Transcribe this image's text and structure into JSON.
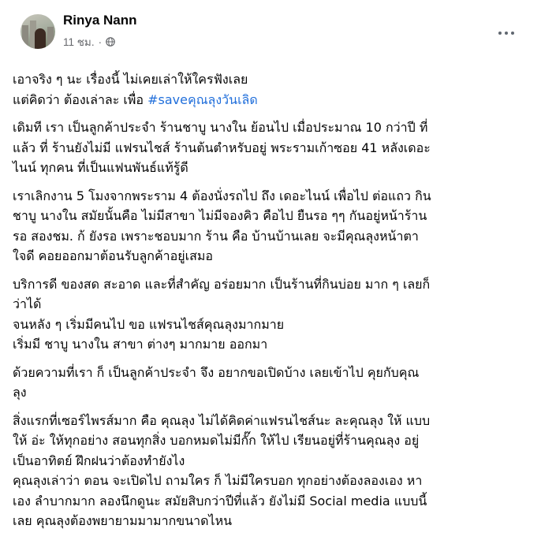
{
  "post": {
    "author": "Rinya Nann",
    "timestamp": "11 ชม.",
    "separator": "·",
    "privacy_icon": "globe-icon",
    "more_icon": "more-options-icon",
    "hashtag_color": "#216fdb",
    "paragraphs": [
      {
        "lines": [
          {
            "text": "เอาจริง ๆ นะ เรื่องนี้ ไม่เคยเล่าให้ใครฟังเลย"
          },
          {
            "text": "แต่คิดว่า ต้องเล่าละ เพื่อ ",
            "hashtag": "#saveคุณลุงวันเลิด"
          }
        ]
      },
      {
        "lines": [
          {
            "text": "เดิมที เรา เป็นลูกค้าประจำ ร้านชาบู นางใน ย้อนไป เมื่อประมาณ 10 กว่าปี ที่"
          },
          {
            "text": "แล้ว ที่ ร้านยังไม่มี แฟรนไชส์ ร้านต้นตำหรับอยู่ พระรามเก้าซอย 41 หลังเดอะ"
          },
          {
            "text": "ไนน์ ทุกคน ที่เป็นแฟนพันธ์แท้รู้ดี"
          }
        ]
      },
      {
        "lines": [
          {
            "text": "เราเลิกงาน 5 โมงจากพระราม 4 ต้องนั่งรถไป ถึง เดอะไนน์ เพื่อไป ต่อแถว กิน"
          },
          {
            "text": "ชาบู นางใน สมัยนั้นคือ ไม่มีสาขา ไม่มีจองคิว คือไป ยืนรอ ๆๆ กันอยู่หน้าร้าน"
          },
          {
            "text": "รอ สองชม. ก้ ยังรอ เพราะชอบมาก ร้าน คือ บ้านบ้านเลย จะมีคุณลุงหน้าตา"
          },
          {
            "text": "ใจดี คอยออกมาต้อนรับลูกค้าอยู่เสมอ"
          }
        ]
      },
      {
        "lines": [
          {
            "text": "บริการดี ของสด สะอาด และที่สำคัญ อร่อยมาก เป็นร้านที่กินบ่อย มาก ๆ เลยก็"
          },
          {
            "text": "ว่าได้"
          },
          {
            "text": "จนหลัง ๆ เริ่มมีคนไป ขอ แฟรนไชส์คุณลุงมากมาย"
          },
          {
            "text": "เริ่มมี ชาบู นางใน สาขา ต่างๆ มากมาย ออกมา"
          }
        ]
      },
      {
        "lines": [
          {
            "text": "ด้วยความที่เรา ก็ เป็นลูกค้าประจำ จึง อยากขอเปิดบ้าง เลยเข้าไป คุยกับคุณ"
          },
          {
            "text": "ลุง"
          }
        ]
      },
      {
        "lines": [
          {
            "text": "สิ่งแรกที่เซอร์ไพรส์มาก คือ คุณลุง ไม่ได้คิดค่าแฟรนไชส์นะ ละคุณลุง ให้ แบบ"
          },
          {
            "text": "ให้ อ่ะ ให้ทุกอย่าง สอนทุกสิ่ง บอกหมดไม่มีกั๊ก ให้ไป เรียนอยู่ที่ร้านคุณลุง อยู่"
          },
          {
            "text": "เป็นอาทิตย์ ฝึกฝนว่าต้องทำยังไง"
          },
          {
            "text": "คุณลุงเล่าว่า ตอน จะเปิดไป ถามใคร ก็ ไม่มีใครบอก ทุกอย่างต้องลองเอง หา"
          },
          {
            "text": "เอง ลำบากมาก ลองนึกดูนะ สมัยสิบกว่าปีที่แล้ว ยังไม่มี Social media แบบนี้"
          },
          {
            "text": "เลย  คุณลุงต้องพยายามมามากขนาดไหน"
          }
        ]
      }
    ]
  }
}
